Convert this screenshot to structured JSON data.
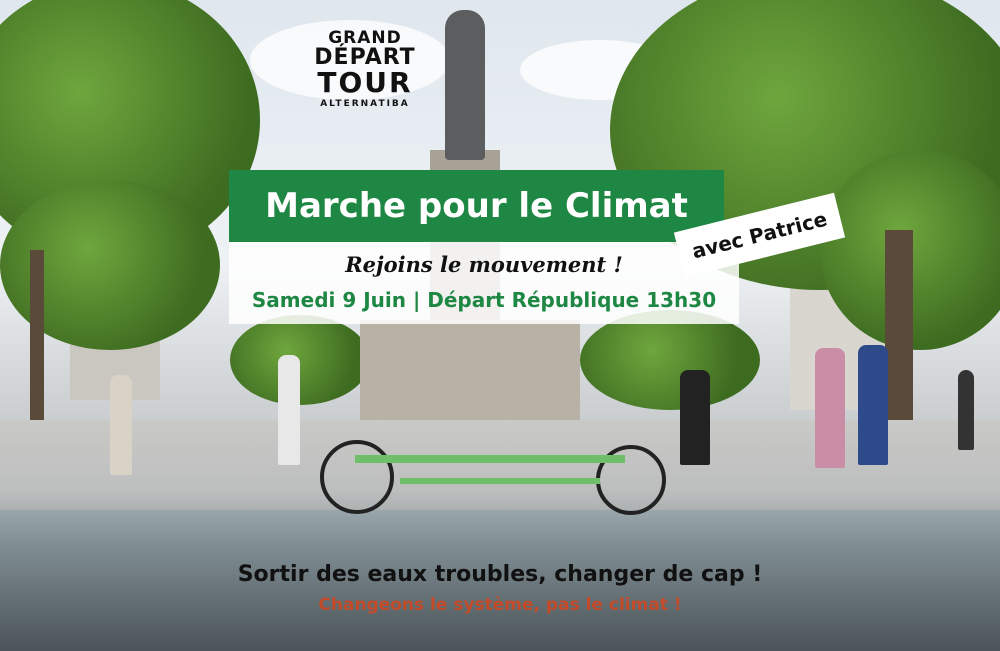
{
  "logo": {
    "line1": "GRAND",
    "line2": "DÉPART",
    "line3": "TOUR",
    "line4": "ALTERNATIBA"
  },
  "banner": {
    "title": "Marche pour le Climat"
  },
  "tagline": "Rejoins le mouvement !",
  "event_info": "Samedi 9 Juin | Départ République 13h30",
  "guest": "avec Patrice",
  "slogan": "Sortir des eaux troubles, changer de cap !",
  "subslogan": "Changeons le système, pas le climat !",
  "colors": {
    "banner_green": "#1e8743",
    "slogan_orange": "#c44b2a"
  }
}
